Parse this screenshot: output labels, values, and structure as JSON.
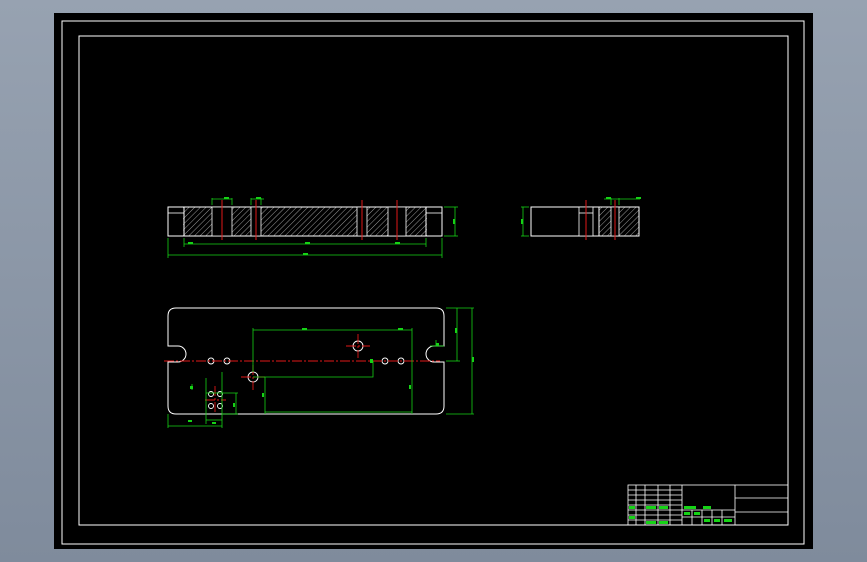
{
  "drawing": {
    "background": "#000000",
    "line_color": "#ffffff",
    "dimension_color": "#16d316",
    "centerline_color": "#e01818",
    "hatch_color": "#8a8a8a"
  },
  "title_block": {
    "cells": []
  }
}
